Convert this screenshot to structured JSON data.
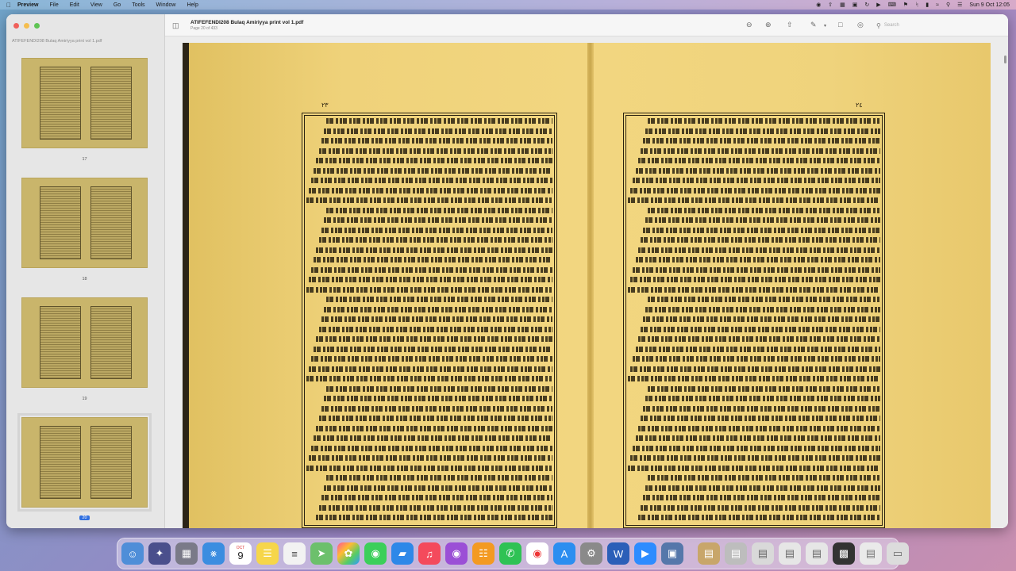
{
  "menubar": {
    "app_name": "Preview",
    "items": [
      "File",
      "Edit",
      "View",
      "Go",
      "Tools",
      "Window",
      "Help"
    ],
    "clock": "Sun 9 Oct  12:05"
  },
  "toolbar": {
    "doc_title": "ATIFEFENDI208 Bulaq Amiriyya print vol 1.pdf",
    "doc_subtitle": "Page 20 of 433",
    "search_placeholder": "Search"
  },
  "sidebar": {
    "title": "ATIFEFENDI208 Bulaq Amiriyya print vol 1.pdf",
    "thumbnails": [
      {
        "label": "17"
      },
      {
        "label": "18"
      },
      {
        "label": "19"
      },
      {
        "label": "20",
        "selected": true
      }
    ]
  },
  "document": {
    "left_page_number": "٢٣",
    "right_page_number": "٢٤"
  },
  "colors": {
    "page_paper": "#f0d47e",
    "ink": "#2b2210",
    "selection_accent": "#2f6fe0"
  },
  "dock": {
    "calendar_month": "OCT",
    "calendar_day": "9"
  }
}
